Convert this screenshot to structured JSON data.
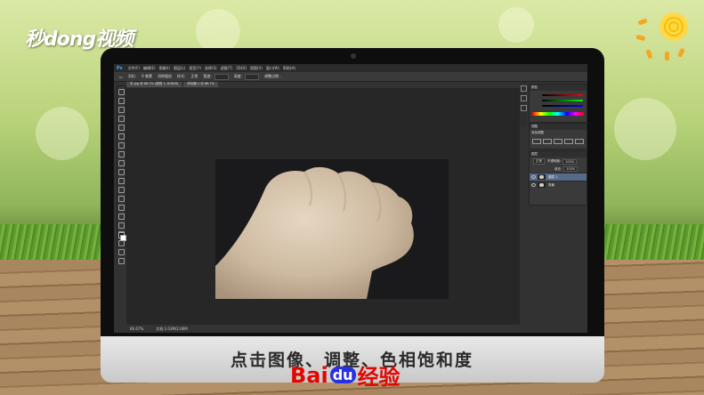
{
  "watermark": {
    "logo_text": "秒dong视频"
  },
  "photoshop": {
    "app_icon": "Ps",
    "menu": [
      "文件(F)",
      "编辑(E)",
      "图像(I)",
      "图层(L)",
      "类型(Y)",
      "选择(S)",
      "滤镜(T)",
      "3D(D)",
      "视图(V)",
      "窗口(W)",
      "帮助(H)"
    ],
    "options_bar": {
      "feather_label": "羽化:",
      "feather_value": "0 像素",
      "antialias": "消除锯齿",
      "style_label": "样式:",
      "style_value": "正常",
      "width_label": "宽度:",
      "height_label": "高度:",
      "refine_edge": "调整边缘..."
    },
    "document_tabs": [
      "手.jpg @ 66.7% (图层 1, RGB/8)",
      "未标题-1 @ 66.7%"
    ],
    "status": {
      "zoom": "66.67%",
      "doc_size": "文档:1.03M/2.06M"
    },
    "panels": {
      "color_title": "颜色",
      "adjustments_title": "调整",
      "adjustments_subtitle": "添加调整",
      "layers_title": "图层",
      "blend_mode": "正常",
      "opacity_label": "不透明度:",
      "opacity_value": "100%",
      "fill_label": "填充:",
      "fill_value": "100%",
      "layers": [
        {
          "name": "图层 1",
          "selected": true
        },
        {
          "name": "背景",
          "selected": false
        }
      ]
    }
  },
  "caption": "点击图像、调整、色相饱和度",
  "brand": {
    "part1": "Bai",
    "part2": "du",
    "part3": "经验"
  }
}
